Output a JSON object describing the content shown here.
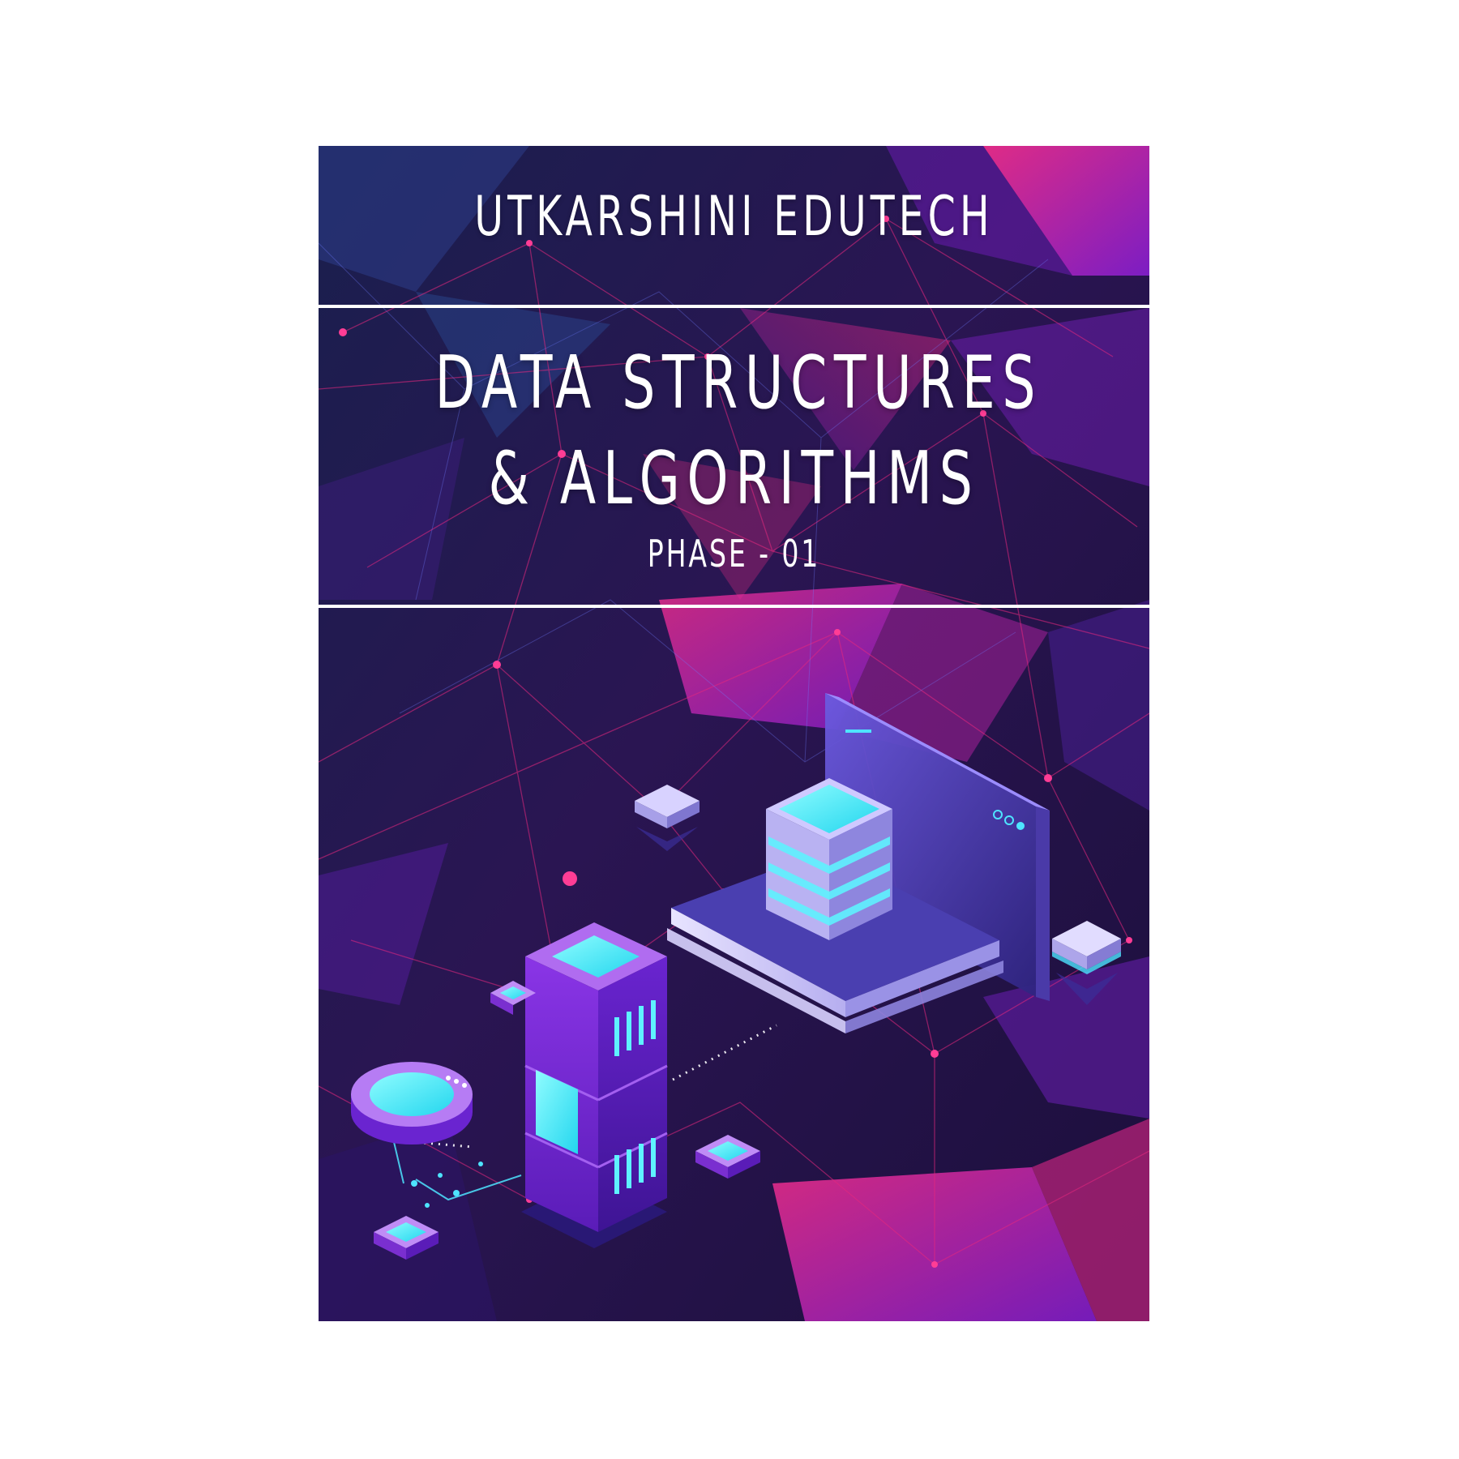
{
  "cover": {
    "publisher": "UTKARSHINI EDUTECH",
    "title_line_1": "DATA STRUCTURES",
    "title_line_2": "& ALGORITHMS",
    "subtitle": "PHASE - 01"
  },
  "colors": {
    "background_dark": "#1e1448",
    "accent_magenta": "#e6287e",
    "accent_purple": "#7a2fd0",
    "accent_cyan": "#3ff0ff",
    "text": "#ffffff"
  },
  "illustration": {
    "icons": [
      "server-tower-icon",
      "laptop-icon",
      "database-stack-icon",
      "storage-disk-icon",
      "chip-node-icon"
    ]
  }
}
